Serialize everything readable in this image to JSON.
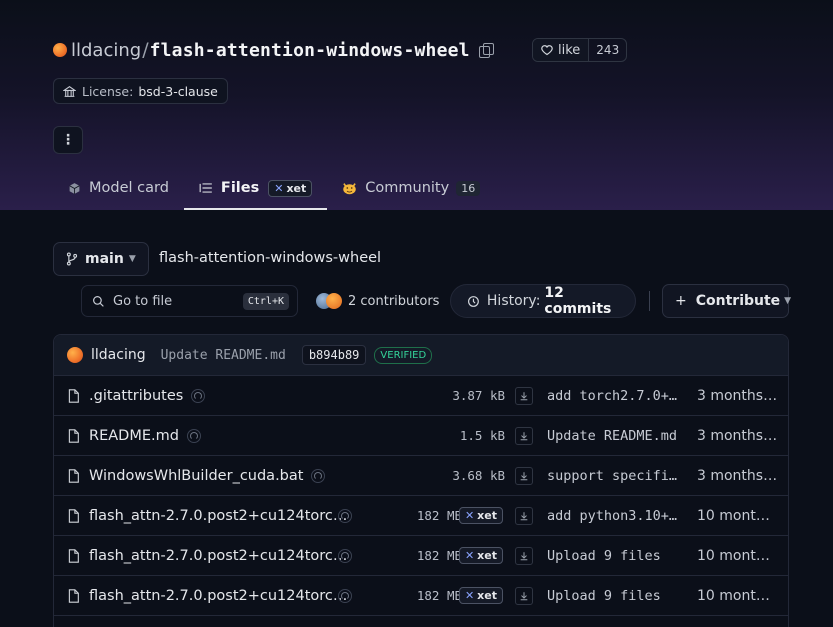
{
  "repo": {
    "owner": "lldacing",
    "separator": "/",
    "name": "flash-attention-windows-wheel",
    "like_label": "like",
    "like_count": "243",
    "license_key": "License:",
    "license_value": "bsd-3-clause",
    "more_label": "⋮"
  },
  "tabs": [
    {
      "label": "Model card",
      "icon": "cube-icon"
    },
    {
      "label": "Files",
      "icon": "files-icon",
      "badge": "xet"
    },
    {
      "label": "Community",
      "icon": "community-icon",
      "count": "16"
    }
  ],
  "toolbar": {
    "branch": "main",
    "breadcrumb": "flash-attention-windows-wheel",
    "goto_placeholder": "Go to file",
    "goto_shortcut": "Ctrl+K",
    "contributors": "2 contributors",
    "history_label": "History:",
    "history_value": "12 commits",
    "contribute_label": "Contribute"
  },
  "last_commit": {
    "author": "lldacing",
    "message": "Update README.md",
    "hash": "b894b89",
    "verified": "VERIFIED"
  },
  "files": [
    {
      "name": ".gitattributes",
      "size": "3.87 kB",
      "xet": "",
      "message": "add torch2.7.0+…",
      "date": "3 months…"
    },
    {
      "name": "README.md",
      "size": "1.5 kB",
      "xet": "",
      "message": "Update README.md",
      "date": "3 months…"
    },
    {
      "name": "WindowsWhlBuilder_cuda.bat",
      "size": "3.68 kB",
      "xet": "",
      "message": "support specifi…",
      "date": "3 months…"
    },
    {
      "name": "flash_attn-2.7.0.post2+cu124torc…",
      "size": "182 MB",
      "xet": "xet",
      "message": "add python3.10+…",
      "date": "10 mont…"
    },
    {
      "name": "flash_attn-2.7.0.post2+cu124torc…",
      "size": "182 MB",
      "xet": "xet",
      "message": "Upload 9 files",
      "date": "10 mont…"
    },
    {
      "name": "flash_attn-2.7.0.post2+cu124torc…",
      "size": "182 MB",
      "xet": "xet",
      "message": "Upload 9 files",
      "date": "10 mont…"
    }
  ],
  "colors": {
    "background": "#0b0f19",
    "header_gradient_end": "#2a1f4a",
    "verified": "#34d399",
    "avatar": "#f0732a"
  }
}
